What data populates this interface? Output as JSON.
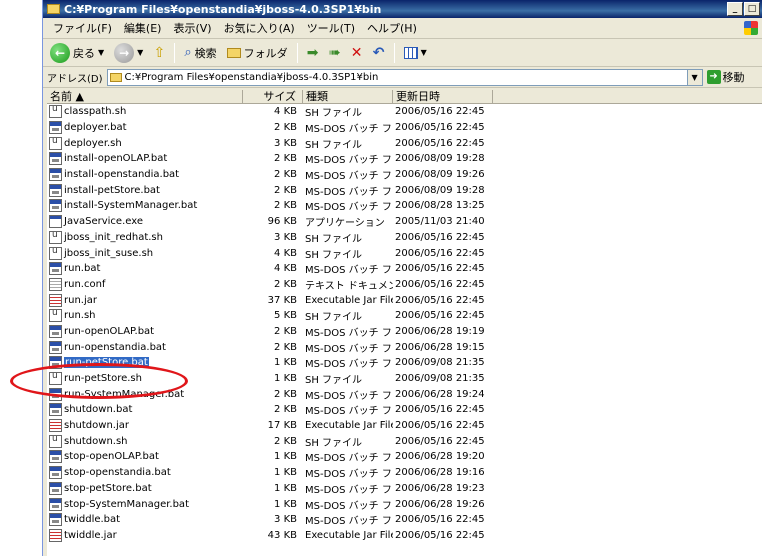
{
  "window": {
    "title": "C:¥Program Files¥openstandia¥jboss-4.0.3SP1¥bin",
    "controls": [
      "_",
      "□"
    ]
  },
  "menu": [
    "ファイル(F)",
    "編集(E)",
    "表示(V)",
    "お気に入り(A)",
    "ツール(T)",
    "ヘルプ(H)"
  ],
  "toolbar": {
    "back_label": "戻る",
    "search_label": "検索",
    "folders_label": "フォルダ"
  },
  "address": {
    "label": "アドレス(D)",
    "value": "C:¥Program Files¥openstandia¥jboss-4.0.3SP1¥bin",
    "go_label": "移動"
  },
  "columns": {
    "name": "名前 ▲",
    "size": "サイズ",
    "type": "種類",
    "modified": "更新日時"
  },
  "files": [
    {
      "name": "classpath.sh",
      "size": "4 KB",
      "type": "SH ファイル",
      "modified": "2006/05/16 22:45",
      "icon": "sh"
    },
    {
      "name": "deployer.bat",
      "size": "2 KB",
      "type": "MS-DOS バッチ ファ...",
      "modified": "2006/05/16 22:45",
      "icon": "bat"
    },
    {
      "name": "deployer.sh",
      "size": "3 KB",
      "type": "SH ファイル",
      "modified": "2006/05/16 22:45",
      "icon": "sh"
    },
    {
      "name": "install-openOLAP.bat",
      "size": "2 KB",
      "type": "MS-DOS バッチ ファ...",
      "modified": "2006/08/09 19:28",
      "icon": "bat"
    },
    {
      "name": "install-openstandia.bat",
      "size": "2 KB",
      "type": "MS-DOS バッチ ファ...",
      "modified": "2006/08/09 19:26",
      "icon": "bat"
    },
    {
      "name": "install-petStore.bat",
      "size": "2 KB",
      "type": "MS-DOS バッチ ファ...",
      "modified": "2006/08/09 19:28",
      "icon": "bat"
    },
    {
      "name": "install-SystemManager.bat",
      "size": "2 KB",
      "type": "MS-DOS バッチ ファ...",
      "modified": "2006/08/28 13:25",
      "icon": "bat"
    },
    {
      "name": "JavaService.exe",
      "size": "96 KB",
      "type": "アプリケーション",
      "modified": "2005/11/03 21:40",
      "icon": "exe"
    },
    {
      "name": "jboss_init_redhat.sh",
      "size": "3 KB",
      "type": "SH ファイル",
      "modified": "2006/05/16 22:45",
      "icon": "sh"
    },
    {
      "name": "jboss_init_suse.sh",
      "size": "4 KB",
      "type": "SH ファイル",
      "modified": "2006/05/16 22:45",
      "icon": "sh"
    },
    {
      "name": "run.bat",
      "size": "4 KB",
      "type": "MS-DOS バッチ ファ...",
      "modified": "2006/05/16 22:45",
      "icon": "bat"
    },
    {
      "name": "run.conf",
      "size": "2 KB",
      "type": "テキスト ドキュメント",
      "modified": "2006/05/16 22:45",
      "icon": "txt"
    },
    {
      "name": "run.jar",
      "size": "37 KB",
      "type": "Executable Jar File",
      "modified": "2006/05/16 22:45",
      "icon": "jar"
    },
    {
      "name": "run.sh",
      "size": "5 KB",
      "type": "SH ファイル",
      "modified": "2006/05/16 22:45",
      "icon": "sh"
    },
    {
      "name": "run-openOLAP.bat",
      "size": "2 KB",
      "type": "MS-DOS バッチ ファ...",
      "modified": "2006/06/28 19:19",
      "icon": "bat"
    },
    {
      "name": "run-openstandia.bat",
      "size": "2 KB",
      "type": "MS-DOS バッチ ファ...",
      "modified": "2006/06/28 19:15",
      "icon": "bat"
    },
    {
      "name": "run-petStore.bat",
      "size": "1 KB",
      "type": "MS-DOS バッチ ファ...",
      "modified": "2006/09/08 21:35",
      "icon": "bat",
      "selected": true
    },
    {
      "name": "run-petStore.sh",
      "size": "1 KB",
      "type": "SH ファイル",
      "modified": "2006/09/08 21:35",
      "icon": "sh"
    },
    {
      "name": "run-SystemManager.bat",
      "size": "2 KB",
      "type": "MS-DOS バッチ ファ...",
      "modified": "2006/06/28 19:24",
      "icon": "bat"
    },
    {
      "name": "shutdown.bat",
      "size": "2 KB",
      "type": "MS-DOS バッチ ファ...",
      "modified": "2006/05/16 22:45",
      "icon": "bat"
    },
    {
      "name": "shutdown.jar",
      "size": "17 KB",
      "type": "Executable Jar File",
      "modified": "2006/05/16 22:45",
      "icon": "jar"
    },
    {
      "name": "shutdown.sh",
      "size": "2 KB",
      "type": "SH ファイル",
      "modified": "2006/05/16 22:45",
      "icon": "sh"
    },
    {
      "name": "stop-openOLAP.bat",
      "size": "1 KB",
      "type": "MS-DOS バッチ ファ...",
      "modified": "2006/06/28 19:20",
      "icon": "bat"
    },
    {
      "name": "stop-openstandia.bat",
      "size": "1 KB",
      "type": "MS-DOS バッチ ファ...",
      "modified": "2006/06/28 19:16",
      "icon": "bat"
    },
    {
      "name": "stop-petStore.bat",
      "size": "1 KB",
      "type": "MS-DOS バッチ ファ...",
      "modified": "2006/06/28 19:23",
      "icon": "bat"
    },
    {
      "name": "stop-SystemManager.bat",
      "size": "1 KB",
      "type": "MS-DOS バッチ ファ...",
      "modified": "2006/06/28 19:26",
      "icon": "bat"
    },
    {
      "name": "twiddle.bat",
      "size": "3 KB",
      "type": "MS-DOS バッチ ファ...",
      "modified": "2006/05/16 22:45",
      "icon": "bat"
    },
    {
      "name": "twiddle.jar",
      "size": "43 KB",
      "type": "Executable Jar File",
      "modified": "2006/05/16 22:45",
      "icon": "jar"
    }
  ],
  "colors": {
    "title_bar": "#0a246a",
    "selection": "#316ac5",
    "annotation": "#e0161a"
  }
}
